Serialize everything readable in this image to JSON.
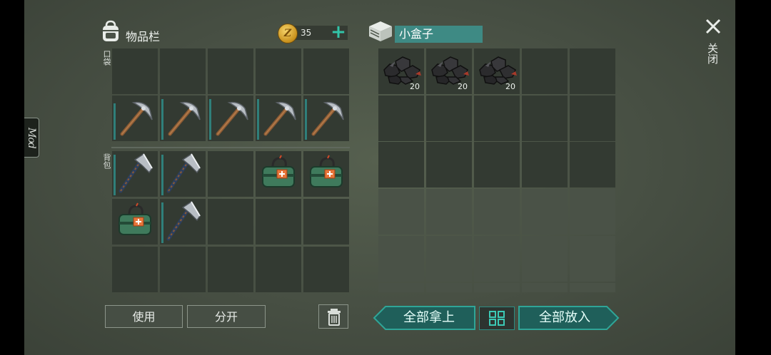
{
  "mod_tab": {
    "label": "Mod"
  },
  "inventory": {
    "title": "物品栏",
    "icon": "backpack-icon",
    "coins": "35",
    "add_coins_icon": "plus-icon",
    "pocket_label": "口袋",
    "backpack_label": "背包"
  },
  "pocket_slots": [
    {
      "item": "",
      "durability": null
    },
    {
      "item": "",
      "durability": null
    },
    {
      "item": "",
      "durability": null
    },
    {
      "item": "",
      "durability": null
    },
    {
      "item": "",
      "durability": null
    },
    {
      "item": "pickaxe",
      "durability": 0.9
    },
    {
      "item": "pickaxe",
      "durability": 1.0
    },
    {
      "item": "pickaxe",
      "durability": 1.0
    },
    {
      "item": "pickaxe",
      "durability": 1.0
    },
    {
      "item": "pickaxe",
      "durability": 1.0
    }
  ],
  "backpack_slots": [
    {
      "item": "hatchet",
      "durability": 1.0
    },
    {
      "item": "hatchet",
      "durability": 1.0
    },
    {
      "item": "",
      "durability": null
    },
    {
      "item": "first-aid-kit",
      "durability": null
    },
    {
      "item": "first-aid-kit",
      "durability": null
    },
    {
      "item": "first-aid-kit",
      "durability": null
    },
    {
      "item": "hatchet",
      "durability": 1.0
    },
    {
      "item": "",
      "durability": null
    },
    {
      "item": "",
      "durability": null
    },
    {
      "item": "",
      "durability": null
    },
    {
      "item": "",
      "durability": null
    },
    {
      "item": "",
      "durability": null
    },
    {
      "item": "",
      "durability": null
    },
    {
      "item": "",
      "durability": null
    },
    {
      "item": "",
      "durability": null
    }
  ],
  "container": {
    "title": "小盒子",
    "icon": "box-icon",
    "slots": [
      {
        "item": "coal",
        "count": "20"
      },
      {
        "item": "coal",
        "count": "20"
      },
      {
        "item": "coal",
        "count": "20"
      },
      {
        "item": "",
        "count": ""
      },
      {
        "item": "",
        "count": ""
      }
    ]
  },
  "close": {
    "label": "关闭",
    "icon": "close-icon"
  },
  "buttons": {
    "use": "使用",
    "split": "分开",
    "trash_icon": "trash-icon",
    "take_all": "全部拿上",
    "sort_icon": "grid-icon",
    "put_all": "全部放入"
  },
  "colors": {
    "accent": "#2c8d83",
    "slot": "#333a32",
    "durability": "#2f7f7a"
  }
}
